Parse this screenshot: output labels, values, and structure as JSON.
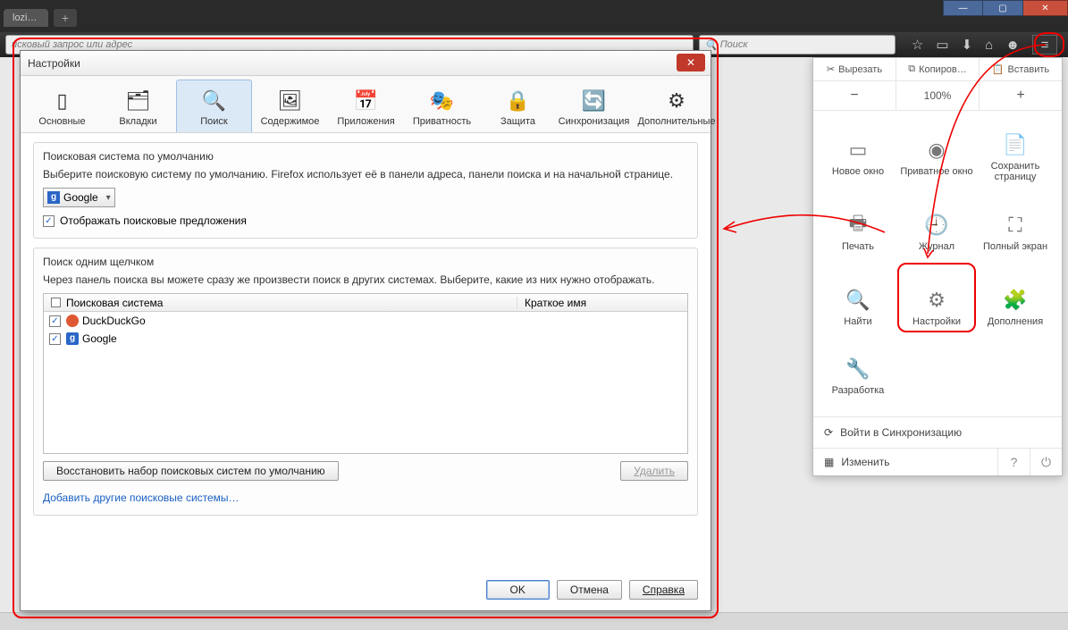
{
  "browser": {
    "tab_label": "lozi…",
    "url_placeholder": "исковый запрос или адрес",
    "search_placeholder": "Поиск"
  },
  "menu": {
    "cut": "Вырезать",
    "copy": "Копиров…",
    "paste": "Вставить",
    "zoom_minus": "−",
    "zoom_value": "100%",
    "zoom_plus": "+",
    "items": [
      {
        "label": "Новое окно",
        "icon": "▭"
      },
      {
        "label": "Приватное окно",
        "icon": "◉"
      },
      {
        "label": "Сохранить страницу",
        "icon": "📄"
      },
      {
        "label": "Печать",
        "icon": "🖶"
      },
      {
        "label": "Журнал",
        "icon": "🕘"
      },
      {
        "label": "Полный экран",
        "icon": "⛶"
      },
      {
        "label": "Найти",
        "icon": "🔍"
      },
      {
        "label": "Настройки",
        "icon": "⚙"
      },
      {
        "label": "Дополнения",
        "icon": "🧩"
      },
      {
        "label": "Разработка",
        "icon": "🔧"
      }
    ],
    "signin": "Войти в Синхронизацию",
    "customize": "Изменить"
  },
  "dialog": {
    "title": "Настройки",
    "tabs": [
      {
        "label": "Основные",
        "icon": "▯"
      },
      {
        "label": "Вкладки",
        "icon": "🗂"
      },
      {
        "label": "Поиск",
        "icon": "🔍"
      },
      {
        "label": "Содержимое",
        "icon": "🖼"
      },
      {
        "label": "Приложения",
        "icon": "📅"
      },
      {
        "label": "Приватность",
        "icon": "🎭"
      },
      {
        "label": "Защита",
        "icon": "🔒"
      },
      {
        "label": "Синхронизация",
        "icon": "🔄"
      },
      {
        "label": "Дополнительные",
        "icon": "⚙"
      }
    ],
    "default_group": {
      "title": "Поисковая система по умолчанию",
      "desc": "Выберите поисковую систему по умолчанию. Firefox использует её в панели адреса, панели поиска и на начальной странице.",
      "selected": "Google",
      "suggestions_label": "Отображать поисковые предложения"
    },
    "oneclick_group": {
      "title": "Поиск одним щелчком",
      "desc": "Через панель поиска вы можете сразу же произвести поиск в других системах. Выберите, какие из них нужно отображать.",
      "col1": "Поисковая система",
      "col2": "Краткое имя",
      "rows": [
        {
          "name": "DuckDuckGo",
          "kind": "ddg"
        },
        {
          "name": "Google",
          "kind": "ggl"
        }
      ],
      "restore": "Восстановить набор поисковых систем по умолчанию",
      "remove": "Удалить",
      "add_link": "Добавить другие поисковые системы…"
    },
    "buttons": {
      "ok": "OK",
      "cancel": "Отмена",
      "help": "Справка"
    }
  }
}
